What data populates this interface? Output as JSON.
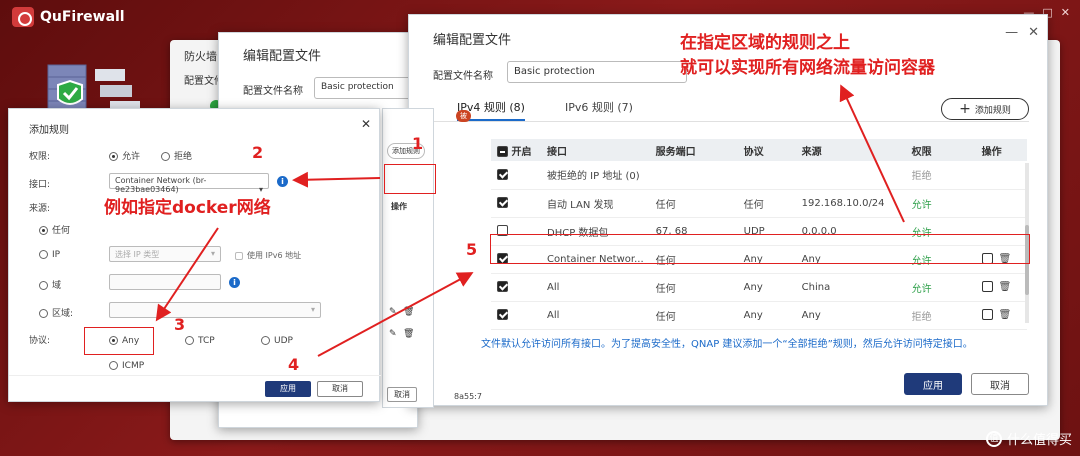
{
  "app": {
    "title": "QuFirewall",
    "window_controls": [
      "—",
      "□",
      "✕"
    ]
  },
  "qufirewall_window": {
    "heading": "防火墙",
    "sub": "配置文件"
  },
  "mid_dialog": {
    "title": "编辑配置文件",
    "profile_label": "配置文件名称",
    "profile_value": "Basic protection"
  },
  "edit_profile": {
    "title": "编辑配置文件",
    "profile_label": "配置文件名称",
    "profile_value": "Basic protection",
    "tabs": [
      {
        "label": "IPv4 规则 (8)"
      },
      {
        "label": "IPv6 规则 (7)"
      }
    ],
    "add_rule": "添加规则",
    "columns": [
      "开启",
      "接口",
      "服务端口",
      "协议",
      "来源",
      "权限",
      "操作"
    ],
    "rows": [
      {
        "enabled": true,
        "iface": "被拒绝的 IP 地址 (0)",
        "port": "",
        "proto": "",
        "source": "",
        "perm": "拒绝",
        "perm_type": "deny",
        "actions": false
      },
      {
        "enabled": true,
        "iface": "自动 LAN 发现",
        "port": "任何",
        "proto": "任何",
        "source": "192.168.10.0/24",
        "perm": "允许",
        "perm_type": "allow",
        "actions": false
      },
      {
        "enabled": false,
        "iface": "DHCP 数据包",
        "port": "67, 68",
        "proto": "UDP",
        "source": "0.0.0.0",
        "perm": "允许",
        "perm_type": "allow",
        "actions": false
      },
      {
        "enabled": true,
        "iface": "Container Networ...",
        "port": "任何",
        "proto": "Any",
        "source": "Any",
        "perm": "允许",
        "perm_type": "allow",
        "actions": true
      },
      {
        "enabled": true,
        "iface": "All",
        "port": "任何",
        "proto": "Any",
        "source": "China",
        "perm": "允许",
        "perm_type": "allow",
        "actions": true
      },
      {
        "enabled": true,
        "iface": "All",
        "port": "任何",
        "proto": "Any",
        "source": "Any",
        "perm": "拒绝",
        "perm_type": "deny",
        "actions": true
      }
    ],
    "note": "文件默认允许访问所有接口。为了提高安全性，QNAP 建议添加一个“全部拒绝”规则，然后允许访问特定接口。",
    "apply": "应用",
    "cancel": "取消"
  },
  "small_panel": {
    "add_rule": "添加规则",
    "ops": "操作",
    "cancel": "取消",
    "badge": "被",
    "mac": "8a55:7"
  },
  "add_rule_dialog": {
    "title": "添加规则",
    "perm_label": "权限:",
    "allow": "允许",
    "deny": "拒绝",
    "iface_label": "接口:",
    "iface_value": "Container Network (br-9e23bae03464)",
    "source_label": "来源:",
    "src_any": "任何",
    "src_ip": "IP",
    "src_ip_placeholder": "选择 IP 类型",
    "use_ipv6": "使用 IPv6 地址",
    "src_domain": "域",
    "src_region": "区域:",
    "proto_label": "协议:",
    "proto_any": "Any",
    "proto_tcp": "TCP",
    "proto_udp": "UDP",
    "proto_icmp": "ICMP",
    "apply": "应用",
    "cancel": "取消"
  },
  "annotations": {
    "top_text_1": "在指定区域的规则之上",
    "top_text_2": "就可以实现所有网络流量访问容器",
    "example_text": "例如指定docker网络",
    "n1": "1",
    "n2": "2",
    "n3": "3",
    "n4": "4",
    "n5": "5",
    "color": "#e02020"
  },
  "watermark": {
    "icon": "值",
    "text": "什么值得买"
  }
}
